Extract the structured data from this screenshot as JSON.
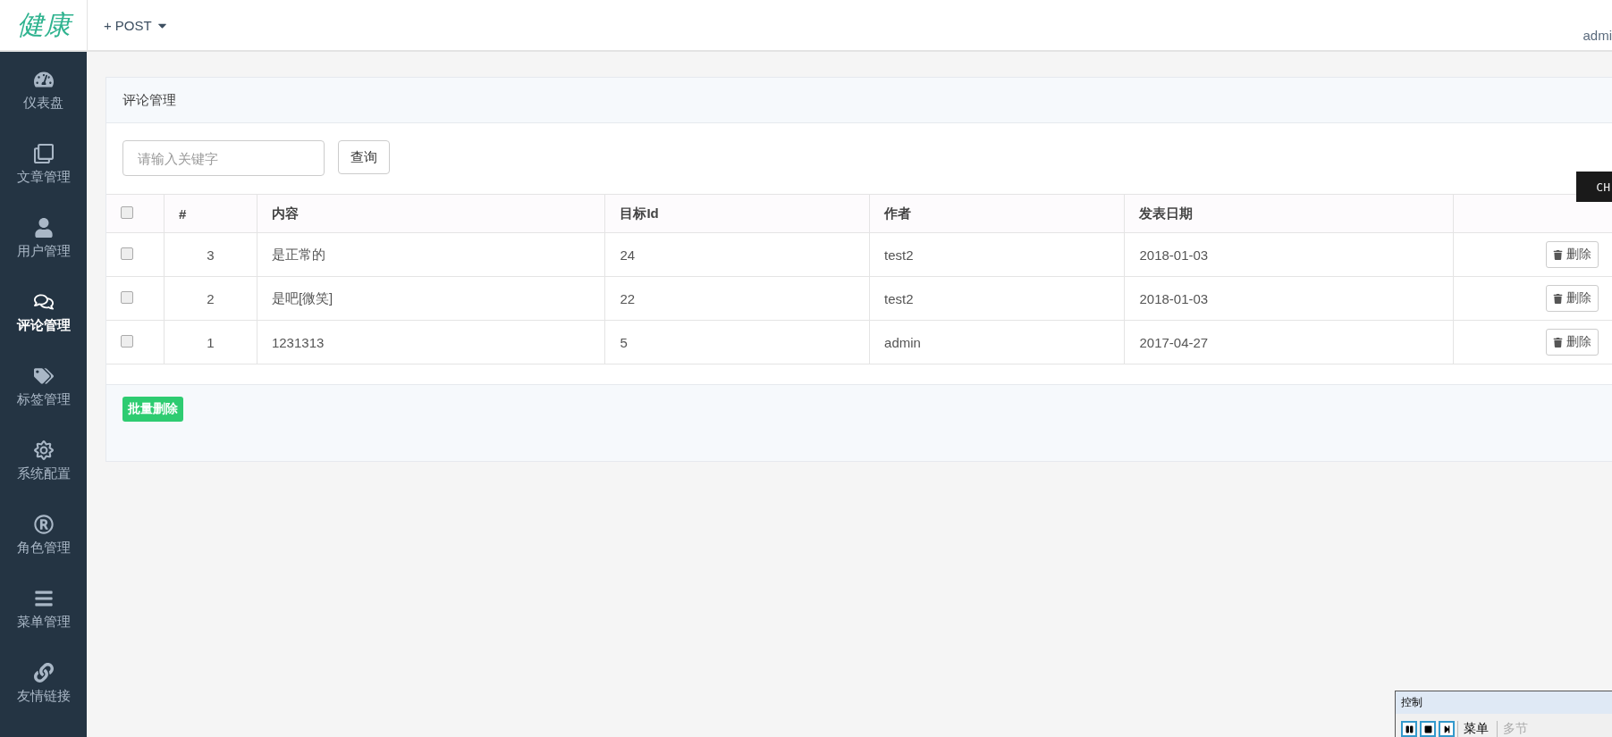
{
  "header": {
    "logo": "健康",
    "new_menu": {
      "icon": "+",
      "label": "POST"
    },
    "user": "admi"
  },
  "sidebar": {
    "items": [
      {
        "label": "仪表盘",
        "selected": false
      },
      {
        "label": "文章管理",
        "selected": false
      },
      {
        "label": "用户管理",
        "selected": false
      },
      {
        "label": "评论管理",
        "selected": true
      },
      {
        "label": "标签管理",
        "selected": false
      },
      {
        "label": "系统配置",
        "selected": false
      },
      {
        "label": "角色管理",
        "selected": false
      },
      {
        "label": "菜单管理",
        "selected": false
      },
      {
        "label": "友情链接",
        "selected": false
      }
    ]
  },
  "panel": {
    "title": "评论管理",
    "search": {
      "placeholder": "请输入关键字",
      "button": "查询"
    },
    "table": {
      "select_all": false,
      "columns": [
        "#",
        "内容",
        "目标Id",
        "作者",
        "发表日期"
      ],
      "rows": [
        {
          "checked": false,
          "id": "3",
          "content": "是正常的",
          "target_id": "24",
          "author": "test2",
          "date": "2018-01-03",
          "action": "删除"
        },
        {
          "checked": false,
          "id": "2",
          "content": "是吧[微笑]",
          "target_id": "22",
          "author": "test2",
          "date": "2018-01-03",
          "action": "删除"
        },
        {
          "checked": false,
          "id": "1",
          "content": "1231313",
          "target_id": "5",
          "author": "admin",
          "date": "2017-04-27",
          "action": "删除"
        }
      ]
    },
    "batch_button": "批量删除"
  },
  "floating_tab": "CH",
  "control_window": {
    "title": "控制",
    "buttons": [
      {
        "label": "菜单",
        "disabled": false
      },
      {
        "label": "多节",
        "disabled": true
      }
    ]
  }
}
